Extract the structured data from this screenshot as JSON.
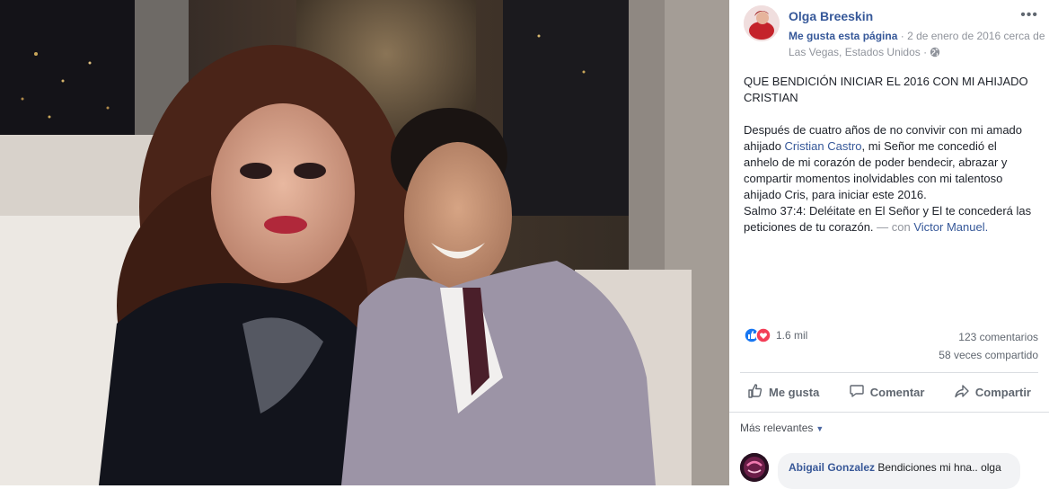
{
  "post": {
    "author": "Olga Breeskin",
    "like_page": "Me gusta esta página",
    "separator": "·",
    "date_location": "2 de enero de 2016 cerca de Las Vegas, Estados Unidos",
    "privacy_icon": "globe-icon",
    "more_label": "•••",
    "headline": "QUE BENDICIÓN INICIAR EL 2016 CON MI AHIJADO CRISTIAN",
    "body_before_link": "Después de cuatro años de no convivir con mi amado ahijado ",
    "tagged_link": "Cristian Castro",
    "body_after_link": ", mi Señor me concedió el anhelo de mi corazón de poder bendecir, abrazar y compartir momentos inolvidables con mi talentoso ahijado Cris, para iniciar este 2016.\nSalmo 37:4: Deléitate en El Señor y El te concederá las peticiones de tu corazón. ",
    "with_prefix": "— con ",
    "with_person": "Victor Manuel."
  },
  "reactions": {
    "count": "1.6 mil",
    "icons": [
      "like-reaction-icon",
      "love-reaction-icon"
    ],
    "colors": {
      "like": "#1877f2",
      "love": "#f33e58"
    },
    "comments": "123 comentarios",
    "shares": "58 veces compartido"
  },
  "actions": {
    "like": "Me gusta",
    "comment": "Comentar",
    "share": "Compartir"
  },
  "sort": {
    "label": "Más relevantes",
    "arrow": "▼"
  },
  "comment": {
    "author": "Abigail Gonzalez",
    "text": " Bendiciones mi hna.. olga"
  },
  "colors": {
    "link": "#365899",
    "meta": "#90949c",
    "bubble": "#f2f3f5"
  }
}
